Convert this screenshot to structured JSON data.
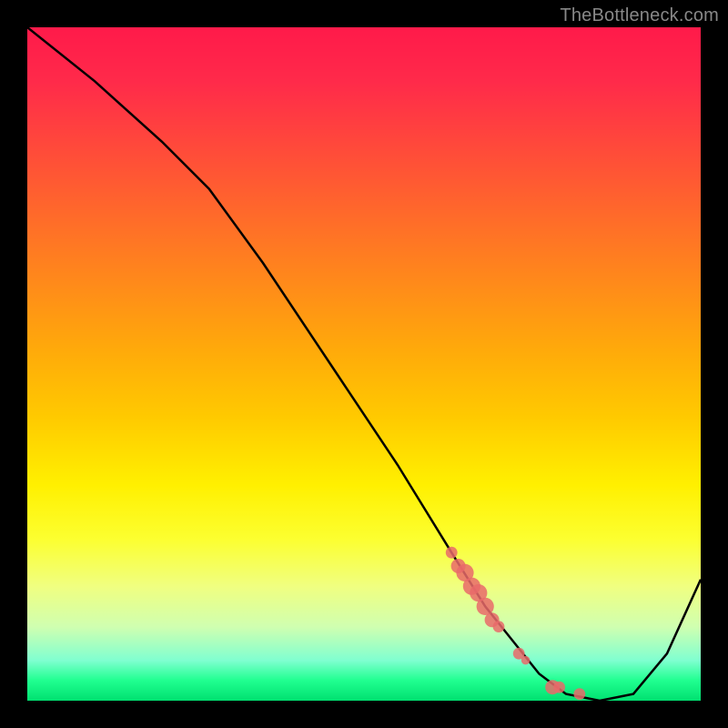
{
  "watermark": "TheBottleneck.com",
  "colors": {
    "background": "#000000",
    "line": "#000000",
    "marker": "#e96a6a",
    "gradient_top": "#ff1a4a",
    "gradient_bottom": "#00e070"
  },
  "chart_data": {
    "type": "line",
    "title": "",
    "xlabel": "",
    "ylabel": "",
    "xlim": [
      0,
      100
    ],
    "ylim": [
      0,
      100
    ],
    "grid": false,
    "annotations": [],
    "series": [
      {
        "name": "bottleneck-curve",
        "x": [
          0,
          10,
          20,
          27,
          35,
          45,
          55,
          63,
          68,
          72,
          76,
          80,
          85,
          90,
          95,
          100
        ],
        "y": [
          100,
          92,
          83,
          76,
          65,
          50,
          35,
          22,
          14,
          9,
          4,
          1,
          0,
          1,
          7,
          18
        ]
      }
    ],
    "markers": [
      {
        "name": "cluster-start",
        "x": 63,
        "y": 22,
        "size": 4
      },
      {
        "name": "cluster-a",
        "x": 64,
        "y": 20,
        "size": 5
      },
      {
        "name": "cluster-b",
        "x": 65,
        "y": 19,
        "size": 6
      },
      {
        "name": "cluster-c",
        "x": 66,
        "y": 17,
        "size": 6
      },
      {
        "name": "cluster-d",
        "x": 67,
        "y": 16,
        "size": 6
      },
      {
        "name": "cluster-e",
        "x": 68,
        "y": 14,
        "size": 6
      },
      {
        "name": "cluster-f",
        "x": 69,
        "y": 12,
        "size": 5
      },
      {
        "name": "cluster-end",
        "x": 70,
        "y": 11,
        "size": 4
      },
      {
        "name": "point-mid1",
        "x": 73,
        "y": 7,
        "size": 4
      },
      {
        "name": "point-mid2",
        "x": 74,
        "y": 6,
        "size": 3
      },
      {
        "name": "point-low1",
        "x": 78,
        "y": 2,
        "size": 5
      },
      {
        "name": "point-low2",
        "x": 79,
        "y": 2,
        "size": 4
      },
      {
        "name": "point-low3",
        "x": 82,
        "y": 1,
        "size": 4
      }
    ]
  }
}
